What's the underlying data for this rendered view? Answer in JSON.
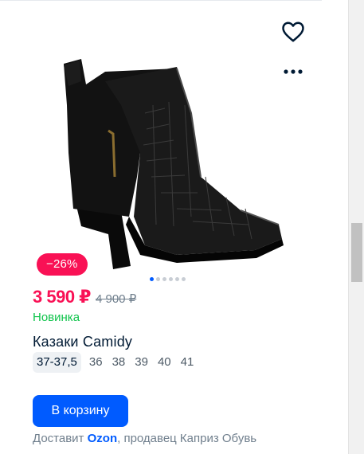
{
  "product": {
    "discount_badge": "−26%",
    "price": "3 590 ₽",
    "old_price": "4 900 ₽",
    "novelty_label": "Новинка",
    "title": "Казаки Camidy",
    "sizes": [
      "37-37,5",
      "36",
      "38",
      "39",
      "40",
      "41"
    ],
    "selected_size": "37-37,5",
    "cart_button_label": "В корзину",
    "delivery": {
      "prefix": "Доставит ",
      "carrier": "Ozon",
      "suffix": ", продавец Каприз Обувь"
    },
    "gallery": {
      "total_images": 6,
      "active_index": 0
    }
  },
  "icons": {
    "favorite": "heart-outline-icon",
    "more": "more-dots-icon"
  },
  "colors": {
    "accent_blue": "#005bff",
    "sale_pink": "#f91155",
    "novelty_green": "#10c44c",
    "muted_text": "#707f8d"
  }
}
